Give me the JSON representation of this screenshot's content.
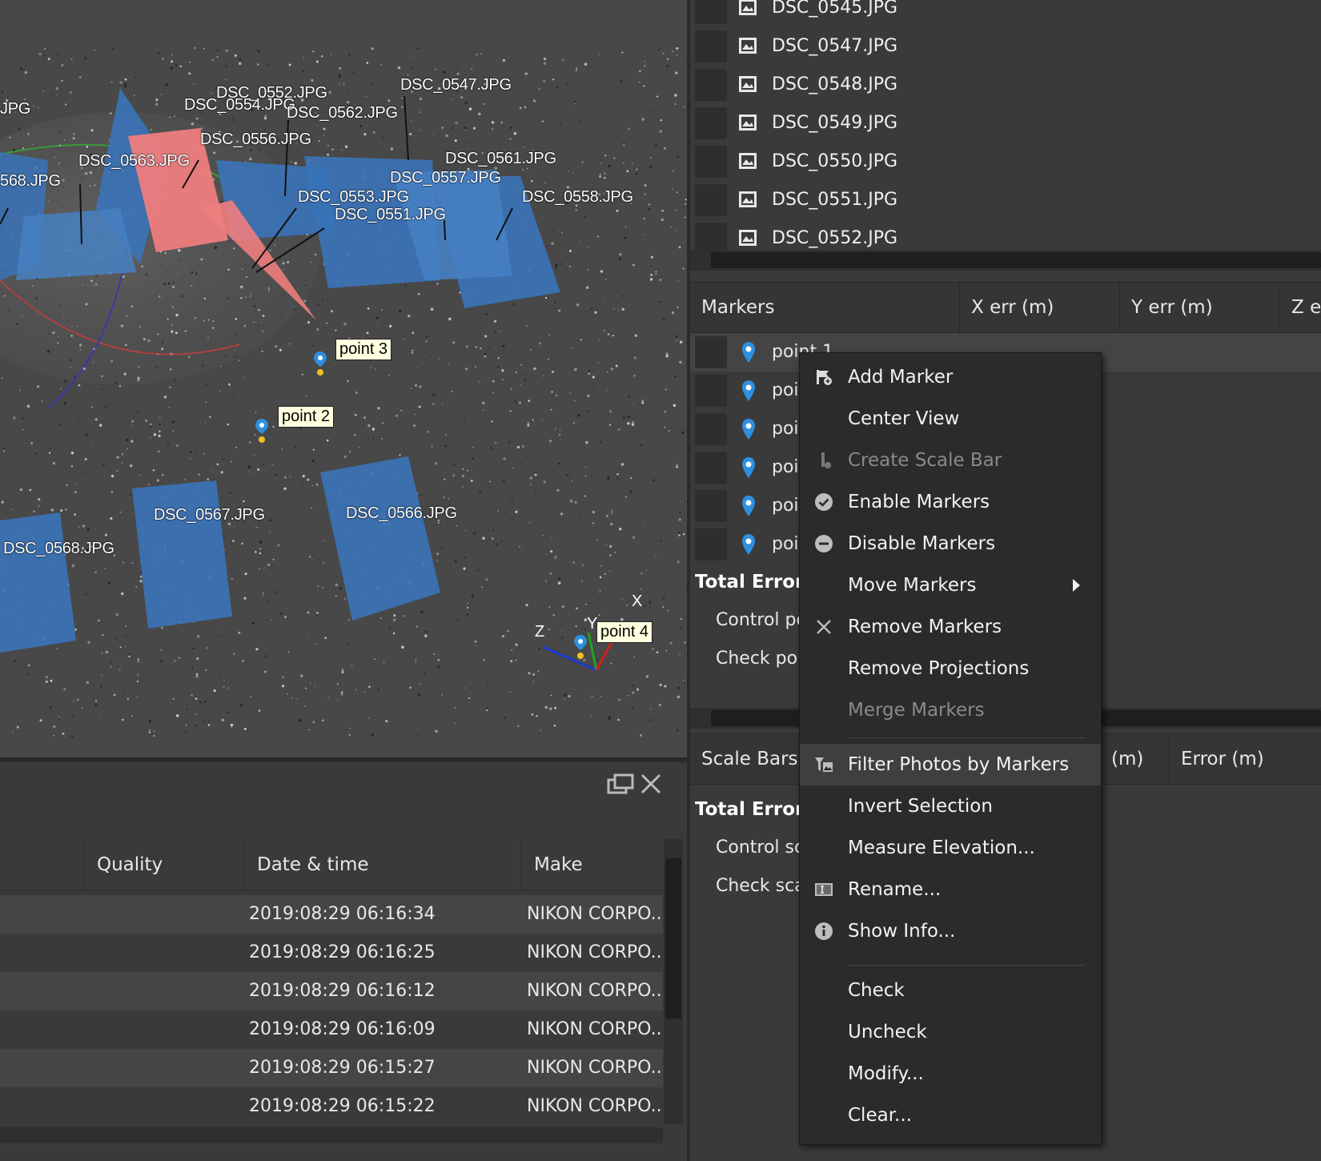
{
  "viewport": {
    "camera_labels": [
      "JPG",
      "DSC_0552.JPG",
      "DSC_0554.JPG",
      "DSC_0562.JPG",
      "DSC_0547.JPG",
      "DSC_0556.JPG",
      "DSC_0563.JPG",
      "DSC_0561.JPG",
      "568.JPG",
      "DSC_0557.JPG",
      "DSC_0553.JPG",
      "DSC_0551.JPG",
      "DSC_0558.JPG",
      "DSC_0567.JPG",
      "DSC_0566.JPG",
      "DSC_0568.JPG"
    ],
    "points": [
      "point 3",
      "point 2",
      "point 4"
    ],
    "axes": {
      "x": "X",
      "y": "Y",
      "z": "Z"
    },
    "colors": {
      "camera": "#3a73b8",
      "selected_camera": "#ee7d7d",
      "point_label_bg": "#ffffe0",
      "marker": "#2d8fe0"
    }
  },
  "photos_pane": {
    "columns": [
      "Quality",
      "Date & time",
      "Make"
    ],
    "rows": [
      {
        "date": "2019:08:29 06:16:34",
        "make": "NIKON CORPO..."
      },
      {
        "date": "2019:08:29 06:16:25",
        "make": "NIKON CORPO..."
      },
      {
        "date": "2019:08:29 06:16:12",
        "make": "NIKON CORPO..."
      },
      {
        "date": "2019:08:29 06:16:09",
        "make": "NIKON CORPO..."
      },
      {
        "date": "2019:08:29 06:15:27",
        "make": "NIKON CORPO..."
      },
      {
        "date": "2019:08:29 06:15:22",
        "make": "NIKON CORPO..."
      }
    ]
  },
  "files": [
    "DSC_0545.JPG",
    "DSC_0547.JPG",
    "DSC_0548.JPG",
    "DSC_0549.JPG",
    "DSC_0550.JPG",
    "DSC_0551.JPG",
    "DSC_0552.JPG"
  ],
  "markers": {
    "columns": [
      "Markers",
      "X err (m)",
      "Y err (m)",
      "Z er"
    ],
    "items": [
      "point 1",
      "poi",
      "poi",
      "poi",
      "poi",
      "poi"
    ],
    "total_error": "Total Error",
    "sub_items": [
      "Control po",
      "Check poi"
    ]
  },
  "scale_bars": {
    "columns": [
      "Scale Bars",
      "(m)",
      "Error (m)"
    ],
    "total_error": "Total Error",
    "sub_items": [
      "Control sc",
      "Check sca"
    ]
  },
  "context_menu": {
    "items": [
      {
        "label": "Add Marker",
        "icon": "add-marker-icon"
      },
      {
        "label": "Center View"
      },
      {
        "label": "Create Scale Bar",
        "icon": "scale-bar-icon",
        "disabled": true
      },
      {
        "label": "Enable Markers",
        "icon": "check-circle-icon"
      },
      {
        "label": "Disable Markers",
        "icon": "minus-circle-icon"
      },
      {
        "label": "Move Markers",
        "submenu": true
      },
      {
        "label": "Remove Markers",
        "icon": "close-icon"
      },
      {
        "label": "Remove Projections"
      },
      {
        "label": "Merge Markers",
        "disabled": true
      },
      {
        "label": "Filter Photos by Markers",
        "icon": "filter-photos-icon",
        "highlight": true
      },
      {
        "label": "Invert Selection"
      },
      {
        "label": "Measure Elevation..."
      },
      {
        "label": "Rename...",
        "icon": "rename-icon"
      },
      {
        "label": "Show Info...",
        "icon": "info-icon"
      },
      {
        "label": "Check"
      },
      {
        "label": "Uncheck"
      },
      {
        "label": "Modify..."
      },
      {
        "label": "Clear..."
      }
    ]
  }
}
